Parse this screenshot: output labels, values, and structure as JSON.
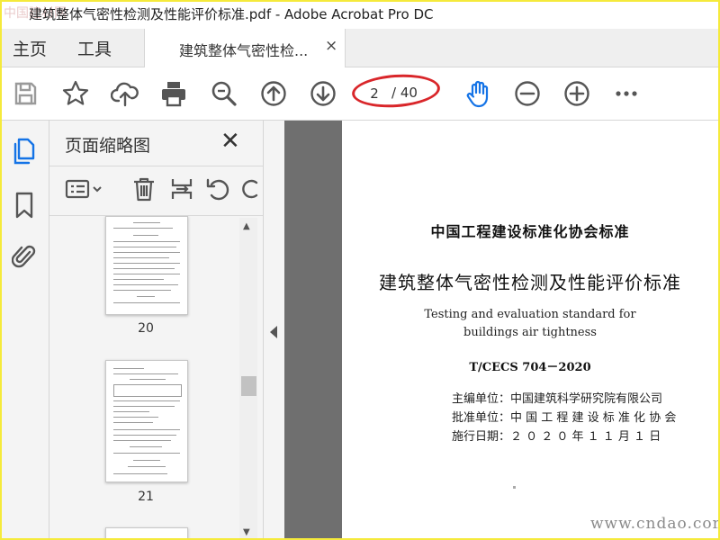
{
  "window": {
    "title": "建筑整体气密性检测及性能评价标准.pdf - Adobe Acrobat Pro DC",
    "watermark_corner": "中国建材网"
  },
  "tabs": {
    "home": "主页",
    "tools": "工具",
    "document": "建筑整体气密性检...",
    "close_symbol": "×"
  },
  "toolbar": {
    "current_page": "2",
    "total_pages": "/ 40",
    "icons": [
      "save-icon",
      "bookmark-star-icon",
      "cloud-upload-icon",
      "print-icon",
      "zoom-search-icon",
      "page-up-icon",
      "page-down-icon",
      "hand-tool-icon",
      "zoom-out-icon",
      "zoom-in-icon",
      "more-icon"
    ],
    "accent": "#1473e6",
    "highlight_ring": "#d9262a"
  },
  "sidebar": {
    "rail_icons": [
      "page-thumbnails-icon",
      "bookmarks-icon",
      "attachments-icon"
    ],
    "panel_title": "页面缩略图",
    "close_symbol": "✕",
    "tool_icons": [
      "thumbnail-options-icon",
      "delete-page-icon",
      "insert-page-icon",
      "rotate-page-icon"
    ],
    "thumbnails": [
      {
        "page": "20"
      },
      {
        "page": "21"
      }
    ]
  },
  "document_page": {
    "org_header": "中国工程建设标准化协会标准",
    "title_cn": "建筑整体气密性检测及性能评价标准",
    "title_en_line1": "Testing and evaluation standard for",
    "title_en_line2": "buildings air tightness",
    "code": "T/CECS 704－2020",
    "editor": "主编单位：中国建筑科学研究院有限公司",
    "approver": "批准单位：中 国 工 程 建 设 标 准 化 协 会",
    "effective": "施行日期：２ ０ ２ ０ 年  １ １ 月  １ 日",
    "watermark": "www.cndao.com"
  }
}
